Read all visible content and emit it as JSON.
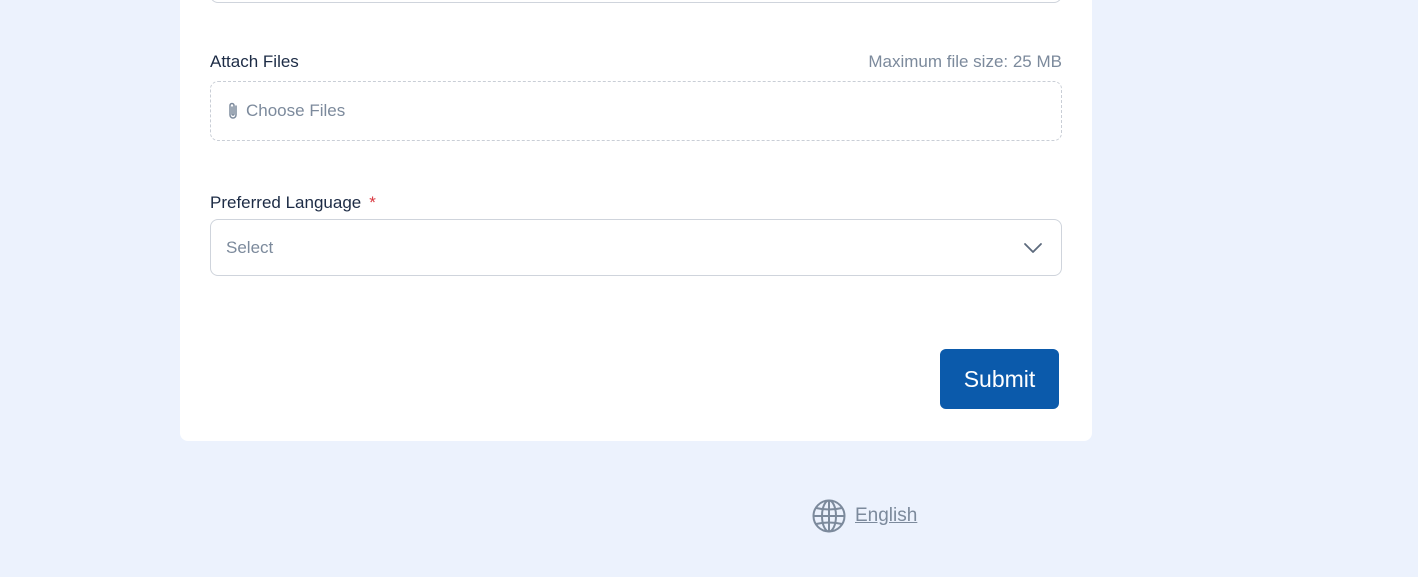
{
  "form": {
    "attach_files": {
      "label": "Attach Files",
      "hint": "Maximum file size: 25 MB",
      "button_text": "Choose Files",
      "icon": "paperclip-icon"
    },
    "preferred_language": {
      "label": "Preferred Language",
      "required_marker": "*",
      "placeholder": "Select",
      "icon": "chevron-down-icon"
    },
    "submit_label": "Submit"
  },
  "footer": {
    "language_label": "English",
    "icon": "globe-icon"
  },
  "colors": {
    "page_bg": "#ecf2fd",
    "card_bg": "#ffffff",
    "primary": "#0b5aab",
    "required": "#d9363e",
    "muted_text": "#7c8a9c",
    "label_text": "#1c2b45"
  }
}
